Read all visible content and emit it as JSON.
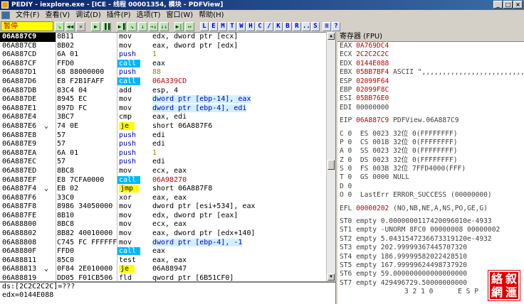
{
  "window": {
    "title": "PEDIY - iexplore.exe - [ICE - 线程 00001354, 模块 - PDFView]",
    "controls": [
      "_",
      "□",
      "×"
    ]
  },
  "menu": [
    "文件(F)",
    "查看(V)",
    "调试(D)",
    "插件(P)",
    "选项(T)",
    "窗口(W)",
    "帮助(H)"
  ],
  "toolbar": {
    "status": "暂停",
    "buttons": [
      "⇘",
      "◀◀",
      "✕",
      "▶",
      "▐▐",
      "▶▐",
      "↘",
      "↓",
      "→↓",
      "↓↓",
      "▶|",
      "↦"
    ],
    "letters": [
      "L",
      "E",
      "M",
      "T",
      "W",
      "H",
      "C",
      "/",
      "K",
      "B",
      "R",
      "...",
      "S",
      "≡",
      "?"
    ]
  },
  "disasm": [
    {
      "addr": "06A887C9",
      "hex": "8B11",
      "mn": "mov",
      "op": "edx, dword ptr [ecx]",
      "sel": true
    },
    {
      "addr": "06A887CB",
      "hex": "8B02",
      "mn": "mov",
      "op": "eax, dword ptr [edx]"
    },
    {
      "addr": "06A887CD",
      "hex": "6A 01",
      "mn": "push",
      "op": "1",
      "ot": "num"
    },
    {
      "addr": "06A887CF",
      "hex": "FFD0",
      "mn": "call",
      "op": "eax"
    },
    {
      "addr": "06A887D1",
      "hex": "68 88000000",
      "mn": "push",
      "op": "88",
      "ot": "num"
    },
    {
      "addr": "06A887D6",
      "hex": "E8 F2B1FAFF",
      "mn": "call",
      "op": "06A339CD",
      "ot": "call"
    },
    {
      "addr": "06A887DB",
      "hex": "83C4 04",
      "mn": "add",
      "op": "esp, 4"
    },
    {
      "addr": "06A887DE",
      "hex": "8945 EC",
      "mn": "mov",
      "op": "dword ptr [ebp-14], eax",
      "ot": "mem"
    },
    {
      "addr": "06A887E1",
      "hex": "897D FC",
      "mn": "mov",
      "op": "dword ptr [ebp-4], edi",
      "ot": "mem"
    },
    {
      "addr": "06A887E4",
      "hex": "3BC7",
      "mn": "cmp",
      "op": "eax, edi"
    },
    {
      "addr": "06A887E6",
      "hex": "74 0E",
      "mn": "je",
      "op": "short 06A887F6",
      "jmark": "⌄"
    },
    {
      "addr": "06A887E8",
      "hex": "57",
      "mn": "push",
      "op": "edi"
    },
    {
      "addr": "06A887E9",
      "hex": "57",
      "mn": "push",
      "op": "edi"
    },
    {
      "addr": "06A887EA",
      "hex": "6A 01",
      "mn": "push",
      "op": "1",
      "ot": "num"
    },
    {
      "addr": "06A887EC",
      "hex": "57",
      "mn": "push",
      "op": "edi"
    },
    {
      "addr": "06A887ED",
      "hex": "8BC8",
      "mn": "mov",
      "op": "ecx, eax"
    },
    {
      "addr": "06A887EF",
      "hex": "E8 7CFA0000",
      "mn": "call",
      "op": "06A98270",
      "ot": "call"
    },
    {
      "addr": "06A887F4",
      "hex": "EB 02",
      "mn": "jmp",
      "op": "short 06A887F8",
      "jmark": "⌄"
    },
    {
      "addr": "06A887F6",
      "hex": "33C0",
      "mn": "xor",
      "op": "eax, eax"
    },
    {
      "addr": "06A887F8",
      "hex": "8986 34050000",
      "mn": "mov",
      "op": "dword ptr [esi+534], eax"
    },
    {
      "addr": "06A887FE",
      "hex": "8B10",
      "mn": "mov",
      "op": "edx, dword ptr [eax]"
    },
    {
      "addr": "06A88800",
      "hex": "8BC8",
      "mn": "mov",
      "op": "ecx, eax"
    },
    {
      "addr": "06A88802",
      "hex": "8B82 40010000",
      "mn": "mov",
      "op": "eax, dword ptr [edx+140]"
    },
    {
      "addr": "06A88808",
      "hex": "C745 FC FFFFFFFF",
      "mn": "mov",
      "op": "dword ptr [ebp-4], -1",
      "ot": "mem"
    },
    {
      "addr": "06A8880F",
      "hex": "FFD0",
      "mn": "call",
      "op": "eax"
    },
    {
      "addr": "06A88811",
      "hex": "85C0",
      "mn": "test",
      "op": "eax, eax"
    },
    {
      "addr": "06A88813",
      "hex": "0F84 2E010000",
      "mn": "je",
      "op": "06A88947",
      "jmark": "⌄"
    },
    {
      "addr": "06A88819",
      "hex": "DD05 F01CB506",
      "mn": "fld",
      "op": "qword ptr [6B51CF0]"
    }
  ],
  "info": [
    "ds:[2C2C2C2C]=???",
    "edx=0144E088"
  ],
  "registers": {
    "header": "寄存器 (FPU)",
    "gpr": [
      {
        "n": "EAX",
        "v": "0A769DC4",
        "c": ""
      },
      {
        "n": "ECX",
        "v": "2C2C2C2C",
        "c": ""
      },
      {
        "n": "EDX",
        "v": "0144E088",
        "c": ""
      },
      {
        "n": "EBX",
        "v": "05BB7BF4",
        "c": "ASCII \",,,,,,,,,,,,,,,,,,,,,,,,,"
      },
      {
        "n": "ESP",
        "v": "02099F64",
        "c": ""
      },
      {
        "n": "EBP",
        "v": "02099F8C",
        "c": ""
      },
      {
        "n": "ESI",
        "v": "05BB76E0",
        "c": ""
      },
      {
        "n": "EDI",
        "v": "00000000",
        "c": "",
        "plain": true
      }
    ],
    "eip": {
      "n": "EIP",
      "v": "06A887C9",
      "c": "PDFView.06A887C9"
    },
    "flags": [
      "C 0  ES 0023 32位 0(FFFFFFFF)",
      "P 0  CS 001B 32位 0(FFFFFFFF)",
      "A 0  SS 0023 32位 0(FFFFFFFF)",
      "Z 0  DS 0023 32位 0(FFFFFFFF)",
      "S 0  FS 003B 32位 7FFD4000(FFF)",
      "T 0  GS 0000 NULL",
      "D 0",
      "O 0  LastErr ERROR_SUCCESS (00000000)"
    ],
    "efl": {
      "n": "EFL",
      "v": "00000202",
      "c": "(NO,NB,NE,A,NS,PO,GE,G)"
    },
    "fpu": [
      "ST0 empty 0.0000000117420096010e-4933",
      "ST1 empty -UNORM 8FC0 00000008 00000002",
      "ST2 empty 5.0431547236673319120e-4932",
      "ST3 empty 202.99999367445707320",
      "ST4 empty 186.99999582022428510",
      "ST5 empty 167.99999624498737920",
      "ST6 empty 59.000000000000000000",
      "ST7 empty 429496729.50000000000"
    ],
    "footer": "3 2 1 0      E S P"
  },
  "stamp": [
    "叙",
    "網",
    "滙",
    "絡"
  ]
}
